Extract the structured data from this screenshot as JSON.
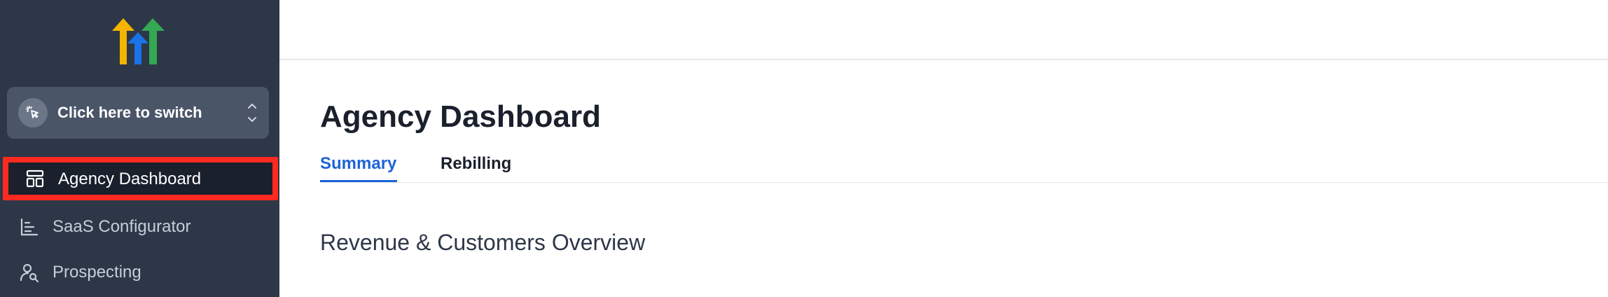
{
  "brand": {
    "logo_icon": "arrows-logo-icon",
    "colors": [
      "#f4b400",
      "#1a73e8",
      "#34a853"
    ]
  },
  "switcher": {
    "label": "Click here to switch",
    "icon": "pointer-click-icon",
    "chevron": "chevron-up-down-icon"
  },
  "sidebar": {
    "items": [
      {
        "label": "Agency Dashboard",
        "icon": "layout-dashboard-icon",
        "active": true
      },
      {
        "label": "SaaS Configurator",
        "icon": "bar-chart-icon",
        "active": false
      },
      {
        "label": "Prospecting",
        "icon": "user-search-icon",
        "active": false
      }
    ]
  },
  "main": {
    "title": "Agency Dashboard",
    "tabs": [
      {
        "label": "Summary",
        "active": true
      },
      {
        "label": "Rebilling",
        "active": false
      }
    ],
    "section_title": "Revenue & Customers Overview"
  },
  "colors": {
    "accent": "#1d63d8",
    "sidebar_bg": "#2d3748",
    "highlight": "#ff2a1f"
  }
}
